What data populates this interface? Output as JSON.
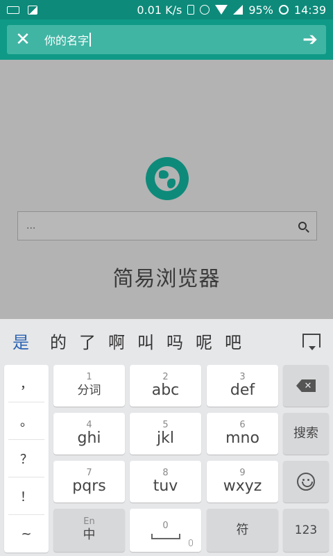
{
  "status_bar": {
    "speed": "0.01 K/s",
    "battery": "95%",
    "time": "14:39",
    "icons": [
      "keyboard-icon",
      "image-icon",
      "vibrate-icon",
      "alarm-icon",
      "wifi-icon",
      "signal-icon",
      "battery-ring-icon"
    ]
  },
  "header": {
    "search_value": "你的名字",
    "close_icon": "close-icon",
    "go_icon": "arrow-right-icon",
    "accent_color": "#0e9a86"
  },
  "main": {
    "search_placeholder": "...",
    "app_title": "简易浏览器"
  },
  "keyboard": {
    "candidates": [
      "是",
      "的",
      "了",
      "啊",
      "叫",
      "吗",
      "呢",
      "吧"
    ],
    "punctuation": [
      "，",
      "。",
      "？",
      "！",
      "~"
    ],
    "keys": {
      "k1": {
        "num": "1",
        "label": "分词"
      },
      "k2": {
        "num": "2",
        "label": "abc"
      },
      "k3": {
        "num": "3",
        "label": "def"
      },
      "k4": {
        "num": "4",
        "label": "ghi"
      },
      "k5": {
        "num": "5",
        "label": "jkl"
      },
      "k6": {
        "num": "6",
        "label": "mno"
      },
      "k7": {
        "num": "7",
        "label": "pqrs"
      },
      "k8": {
        "num": "8",
        "label": "tuv"
      },
      "k9": {
        "num": "9",
        "label": "wxyz"
      },
      "lang": {
        "top": "En",
        "label": "中"
      },
      "space": {
        "num": "0"
      },
      "symbol": "符",
      "search": "搜索",
      "numeric": "123",
      "backspace_mark": "✕"
    }
  }
}
